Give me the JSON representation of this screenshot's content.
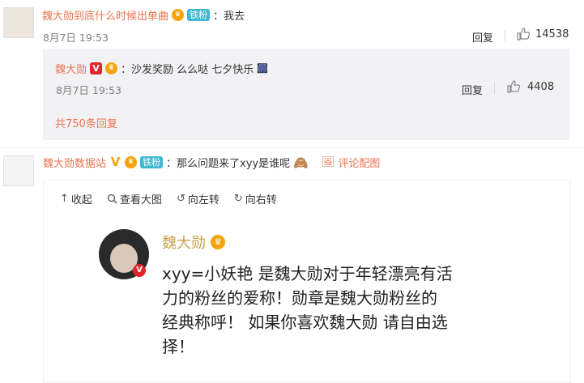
{
  "comment1": {
    "username": "魏大勋到底什么时候出单曲",
    "fan_badge": "铁粉",
    "text": "：我去",
    "date": "8月7日 19:53",
    "reply_label": "回复",
    "likes": "14538"
  },
  "reply1": {
    "username": "魏大勋",
    "text": "：沙发奖励 么么哒 七夕快乐",
    "date": "8月7日 19:53",
    "reply_label": "回复",
    "likes": "4408",
    "more_replies": "共750条回复"
  },
  "comment2": {
    "username": "魏大勋数据站",
    "fan_badge": "铁粉",
    "text": "：那么问题来了xyy是谁呢",
    "image_link": "评论配图"
  },
  "image_toolbar": {
    "collapse": "收起",
    "view_large": "查看大图",
    "rotate_left": "向左转",
    "rotate_right": "向右转"
  },
  "embedded_image": {
    "name": "魏大勋",
    "text_line1": "xyy=小妖艳 是魏大勋对于年轻漂亮有活",
    "text_line2": "力的粉丝的爱称！勋章是魏大勋粉丝的",
    "text_line3": "经典称呼！ 如果你喜欢魏大勋 请自由选",
    "text_line4": "择！"
  },
  "colors": {
    "accent": "#eb7350",
    "fan_badge": "#3fb8d1",
    "crown": "#f4a40a",
    "v_red": "#e0252b"
  },
  "icons": [
    "thumbs-up-icon",
    "emoji-icon",
    "picture-icon",
    "arrow-up-icon",
    "search-icon",
    "rotate-left-icon",
    "rotate-right-icon"
  ]
}
